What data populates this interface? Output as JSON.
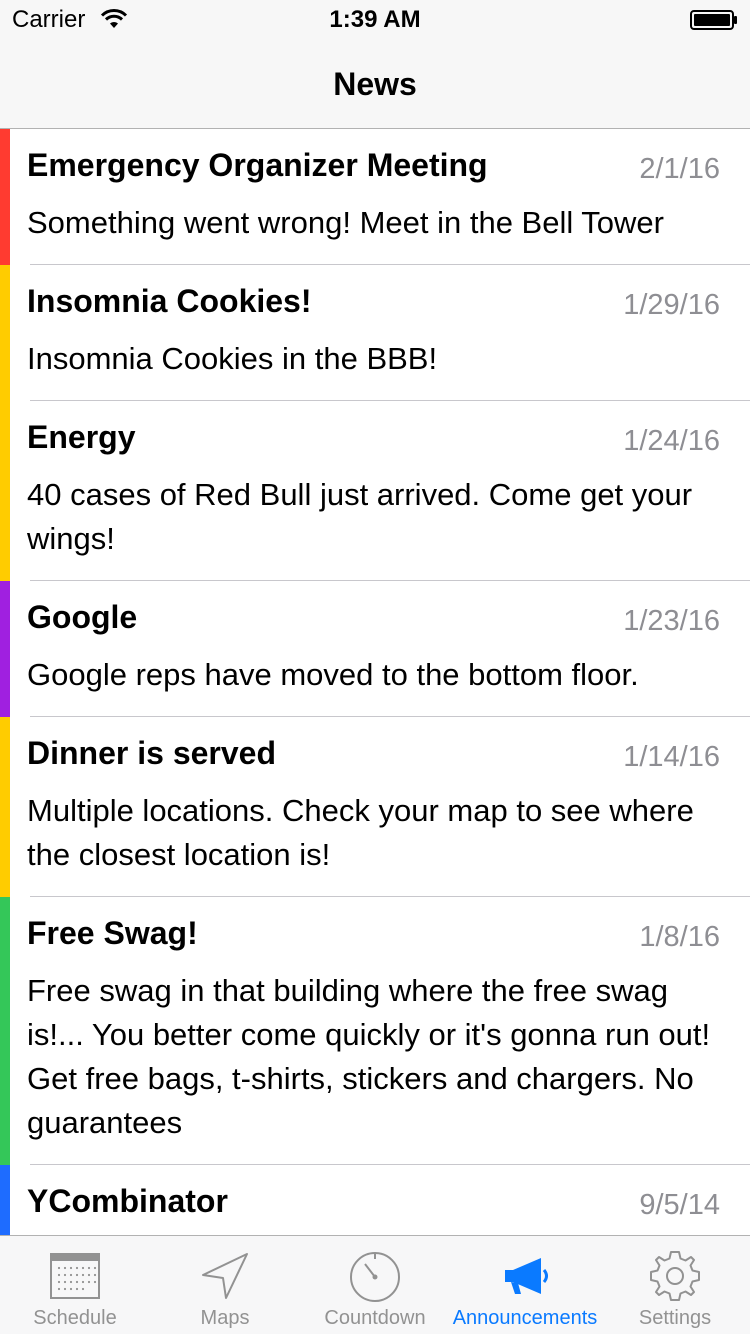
{
  "status_bar": {
    "carrier": "Carrier",
    "time": "1:39 AM"
  },
  "nav": {
    "title": "News"
  },
  "news": [
    {
      "title": "Emergency Organizer Meeting",
      "date": "2/1/16",
      "body": "Something went wrong! Meet in the Bell Tower",
      "color": "#ff3b30"
    },
    {
      "title": "Insomnia Cookies!",
      "date": "1/29/16",
      "body": "Insomnia Cookies in the BBB!",
      "color": "#ffcc00"
    },
    {
      "title": "Energy",
      "date": "1/24/16",
      "body": "40 cases of Red Bull just arrived. Come get your wings!",
      "color": "#ffcc00"
    },
    {
      "title": "Google",
      "date": "1/23/16",
      "body": "Google reps have moved to the bottom floor.",
      "color": "#a020e0"
    },
    {
      "title": "Dinner is served",
      "date": "1/14/16",
      "body": "Multiple locations. Check your map to see where the closest location is!",
      "color": "#ffcc00"
    },
    {
      "title": "Free Swag!",
      "date": "1/8/16",
      "body": "Free swag in that building where the free swag is!... You better come quickly or it's gonna run out! Get free bags, t-shirts, stickers and chargers. No guarantees",
      "color": "#34c759"
    },
    {
      "title": "YCombinator",
      "date": "9/5/14",
      "body": "",
      "color": "#1e6cff"
    }
  ],
  "tabs": [
    {
      "label": "Schedule",
      "icon": "calendar-icon",
      "active": false
    },
    {
      "label": "Maps",
      "icon": "navigation-arrow-icon",
      "active": false
    },
    {
      "label": "Countdown",
      "icon": "stopwatch-icon",
      "active": false
    },
    {
      "label": "Announcements",
      "icon": "megaphone-icon",
      "active": true
    },
    {
      "label": "Settings",
      "icon": "gear-icon",
      "active": false
    }
  ],
  "colors": {
    "accent": "#0a7aff",
    "inactive": "#929292"
  }
}
